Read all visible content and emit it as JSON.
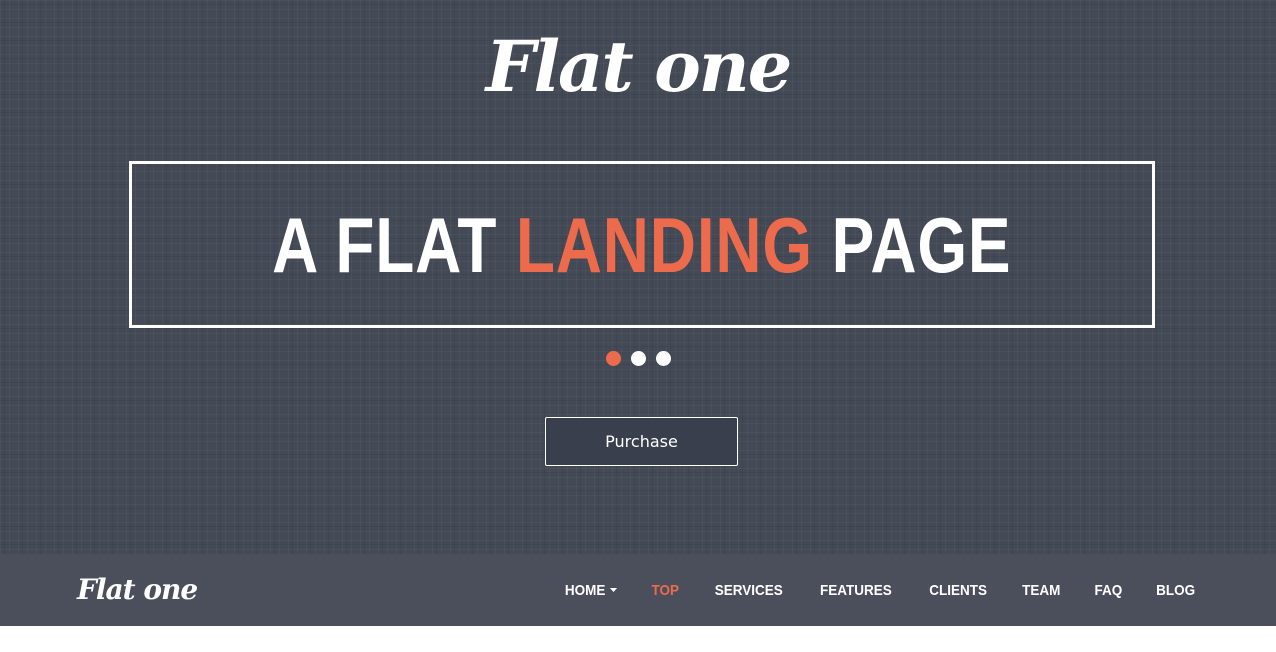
{
  "hero": {
    "logo": "Flat one",
    "headline": {
      "part1": "A FLAT ",
      "accent": "LANDING",
      "part2": " PAGE"
    },
    "slider": {
      "count": 3,
      "active_index": 0
    },
    "purchase_label": "Purchase"
  },
  "navbar": {
    "logo": "Flat one",
    "items": [
      {
        "label": "HOME",
        "has_dropdown": true,
        "active": false
      },
      {
        "label": "TOP",
        "has_dropdown": false,
        "active": true
      },
      {
        "label": "SERVICES",
        "has_dropdown": false,
        "active": false
      },
      {
        "label": "FEATURES",
        "has_dropdown": false,
        "active": false
      },
      {
        "label": "CLIENTS",
        "has_dropdown": false,
        "active": false
      },
      {
        "label": "TEAM",
        "has_dropdown": false,
        "active": false
      },
      {
        "label": "FAQ",
        "has_dropdown": false,
        "active": false
      },
      {
        "label": "BLOG",
        "has_dropdown": false,
        "active": false
      }
    ]
  },
  "colors": {
    "hero_background": "#434955",
    "navbar_background": "#4a4f5b",
    "accent": "#ec6b4d",
    "text": "#ffffff"
  },
  "icons": {
    "dropdown": "caret-down-icon"
  }
}
